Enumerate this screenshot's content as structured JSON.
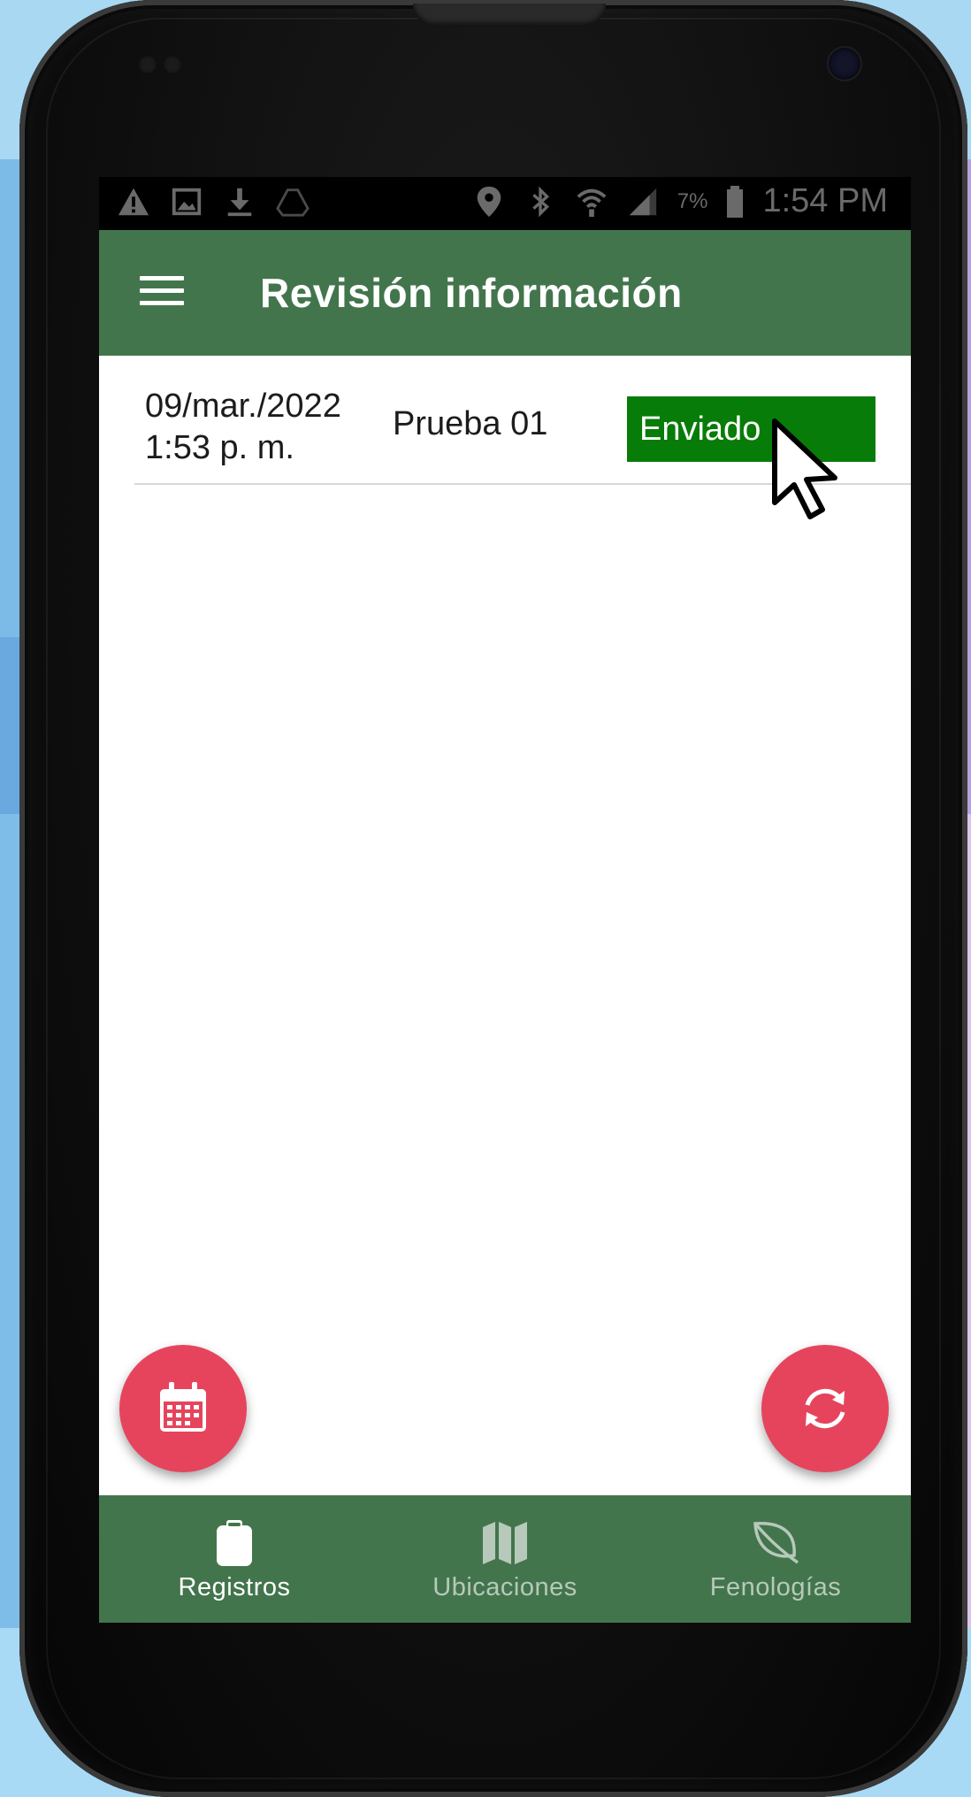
{
  "status_bar": {
    "battery": "7%",
    "time": "1:54 PM",
    "left_icons": [
      "warning-icon",
      "image-icon",
      "download-icon",
      "drive-icon"
    ],
    "right_icons": [
      "location-icon",
      "bluetooth-icon",
      "wifi-icon",
      "signal-icon",
      "battery-icon"
    ]
  },
  "app_bar": {
    "title": "Revisión información",
    "menu_icon": "hamburger-menu-icon"
  },
  "records": [
    {
      "date": "09/mar./2022",
      "time": "1:53 p. m.",
      "name": "Prueba 01",
      "status": "Enviado"
    }
  ],
  "fabs": {
    "left_icon": "calendar-icon",
    "right_icon": "sync-icon"
  },
  "bottom_nav": {
    "items": [
      {
        "label": "Registros",
        "icon": "clipboard-icon",
        "active": true
      },
      {
        "label": "Ubicaciones",
        "icon": "map-icon",
        "active": false
      },
      {
        "label": "Fenologías",
        "icon": "leaf-icon",
        "active": false
      }
    ]
  },
  "colors": {
    "app_bar": "#43754c",
    "status_badge": "#087c08",
    "fab": "#e6445d",
    "background_blue": "#86c3ec",
    "background_purple": "#d5b4e6"
  }
}
